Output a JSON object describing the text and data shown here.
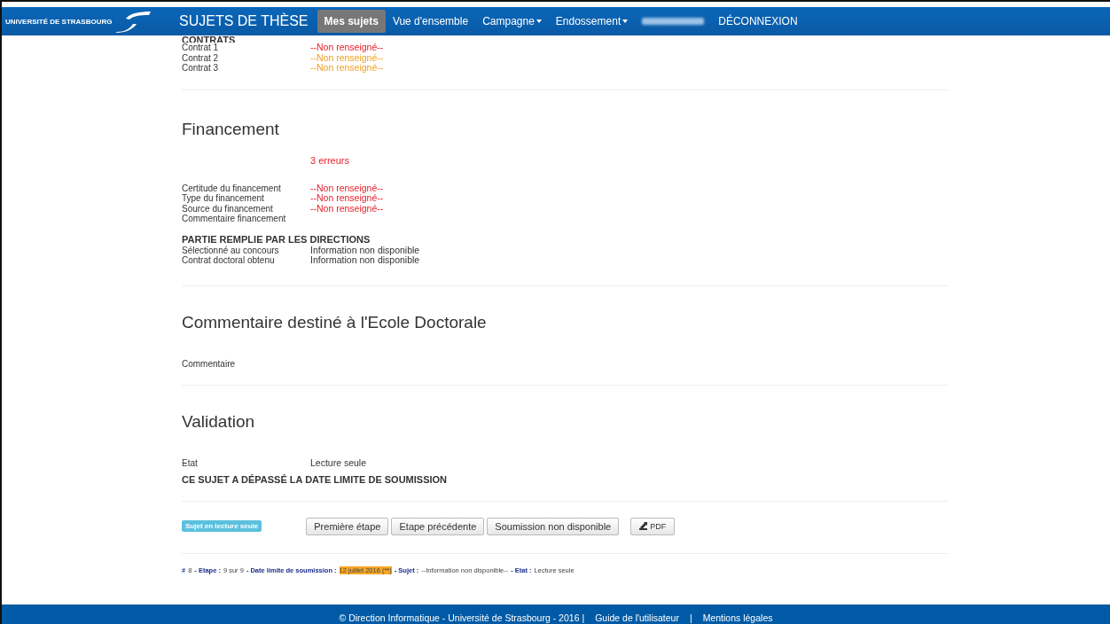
{
  "navbar": {
    "logo_text": "UNIVERSITÉ DE STRASBOURG",
    "brand": "SUJETS DE THÈSE",
    "items": [
      {
        "label": "Mes sujets",
        "selected": true,
        "dropdown": false
      },
      {
        "label": "Vue d'ensemble",
        "selected": false,
        "dropdown": false
      },
      {
        "label": "Campagne",
        "selected": false,
        "dropdown": true
      },
      {
        "label": "Endossement",
        "selected": false,
        "dropdown": true
      }
    ],
    "logout": "DÉCONNEXION"
  },
  "contracts": {
    "heading": "CONTRATS",
    "rows": [
      {
        "label": "Contrat 1",
        "value": "--Non renseigné--",
        "color": "#e8202a"
      },
      {
        "label": "Contrat 2",
        "value": "--Non renseigné--",
        "color": "#f0a020"
      },
      {
        "label": "Contrat 3",
        "value": "--Non renseigné--",
        "color": "#f0a020"
      }
    ]
  },
  "sections": [
    {
      "title": "Financement",
      "errors": "3 erreurs",
      "rows": [
        {
          "label": "Certitude du financement",
          "value": "--Non renseigné--",
          "missing": true
        },
        {
          "label": "Type du financement",
          "value": "--Non renseigné--",
          "missing": true
        },
        {
          "label": "Source du financement",
          "value": "--Non renseigné--",
          "missing": true
        },
        {
          "label": "Commentaire financement"
        }
      ],
      "subheading": "PARTIE REMPLIE PAR LES DIRECTIONS",
      "subrows": [
        {
          "label": "Sélectionné au concours",
          "value": "Information non disponible",
          "missing": false
        },
        {
          "label": "Contrat doctoral obtenu",
          "value": "Information non disponible",
          "missing": false
        }
      ]
    },
    {
      "title": "Commentaire destiné à l'Ecole Doctorale",
      "rows": [
        {
          "label": "Commentaire"
        }
      ]
    },
    {
      "title": "Validation",
      "rows": [
        {
          "label": "Etat",
          "value": "Lecture seule",
          "missing": false
        }
      ],
      "notice": "CE SUJET A DÉPASSÉ LA DATE LIMITE DE SOUMISSION"
    }
  ],
  "actions": {
    "badge": "Sujet en lecture seule",
    "buttons": [
      "Première étape",
      "Etape précédente",
      "Soumission non disponible"
    ],
    "pdf": "PDF"
  },
  "status_line": [
    {
      "label": "#",
      "value": "8",
      "highlighted": false
    },
    {
      "label": "- Etape :",
      "value": "9 sur 9",
      "highlighted": false
    },
    {
      "label": "- Date limite de soumission :",
      "value": "12 juillet 2016 (**)",
      "highlighted": true
    },
    {
      "label": "- Sujet :",
      "value": "--Information non disponible--",
      "highlighted": false
    },
    {
      "label": "- Etat :",
      "value": "Lecture seule",
      "highlighted": false
    }
  ],
  "footer": {
    "copyright": "© Direction Informatique - Université de Strasbourg - 2016 |",
    "separator": "|",
    "links": [
      "Guide de l'utilisateur",
      "Mentions légales"
    ]
  }
}
